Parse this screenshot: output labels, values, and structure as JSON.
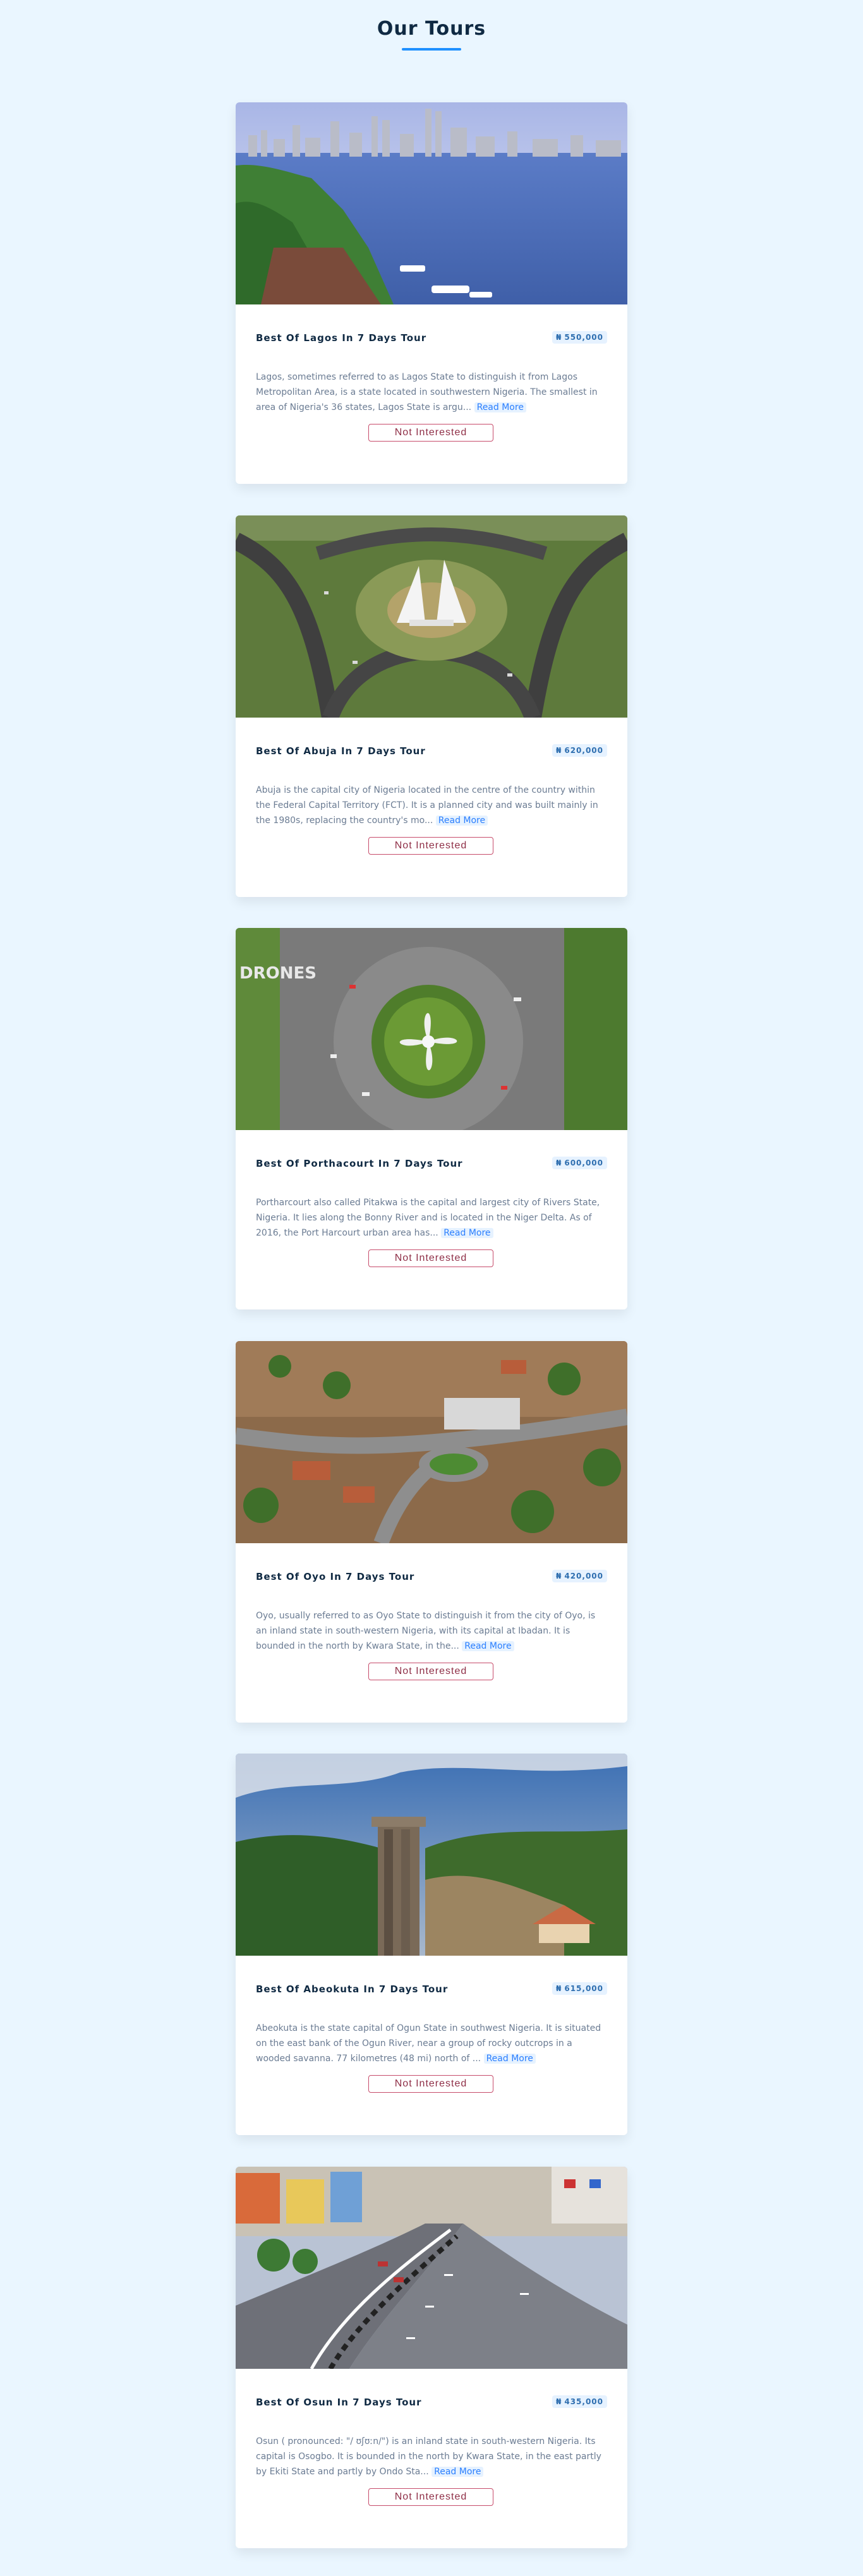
{
  "header": {
    "title": "Our Tours"
  },
  "tours": [
    {
      "name": "Best Of Lagos In 7 Days Tour",
      "price": "550,000",
      "currency_symbol": "₦",
      "description": "Lagos, sometimes referred to as Lagos State to distinguish it from Lagos Metropolitan Area, is a state located in southwestern Nigeria. The smallest in area of Nigeria's 36 states, Lagos State is argu...",
      "read_more": "Read More",
      "button_label": "Not Interested",
      "image": "lagos-skyline-lagoon"
    },
    {
      "name": "Best Of Abuja In 7 Days Tour",
      "price": "620,000",
      "currency_symbol": "₦",
      "description": "Abuja is the capital city of Nigeria located in the centre of the country within the Federal Capital Territory (FCT). It is a planned city and was built mainly in the 1980s, replacing the country's mo...",
      "read_more": "Read More",
      "button_label": "Not Interested",
      "image": "abuja-city-gate-interchange"
    },
    {
      "name": "Best Of Porthacourt In 7 Days Tour",
      "price": "600,000",
      "currency_symbol": "₦",
      "description": "Portharcourt also called Pitakwa is the capital and largest city of Rivers State, Nigeria. It lies along the Bonny River and is located in the Niger Delta. As of 2016, the Port Harcourt urban area has...",
      "read_more": "Read More",
      "button_label": "Not Interested",
      "image": "port-harcourt-roundabout",
      "watermark": "DRONES"
    },
    {
      "name": "Best Of Oyo In 7 Days Tour",
      "price": "420,000",
      "currency_symbol": "₦",
      "description": "Oyo, usually referred to as Oyo State to distinguish it from the city of Oyo, is an inland state in south-western Nigeria, with its capital at Ibadan. It is bounded in the north by Kwara State, in the...",
      "read_more": "Read More",
      "button_label": "Not Interested",
      "image": "ibadan-aerial-roundabout"
    },
    {
      "name": "Best Of Abeokuta In 7 Days Tour",
      "price": "615,000",
      "currency_symbol": "₦",
      "description": "Abeokuta is the state capital of Ogun State in southwest Nigeria. It is situated on the east bank of the Ogun River, near a group of rocky outcrops in a wooded savanna. 77 kilometres (48 mi) north of ...",
      "read_more": "Read More",
      "button_label": "Not Interested",
      "image": "olumo-rock-tower"
    },
    {
      "name": "Best Of Osun In 7 Days Tour",
      "price": "435,000",
      "currency_symbol": "₦",
      "description": "Osun ( pronounced: \"/ ʊʃʊːn/\") is an inland state in south-western Nigeria. Its capital is Osogbo. It is bounded in the north by Kwara State, in the east partly by Ekiti State and partly by Ondo Sta...",
      "read_more": "Read More",
      "button_label": "Not Interested",
      "image": "osogbo-curved-road"
    }
  ]
}
